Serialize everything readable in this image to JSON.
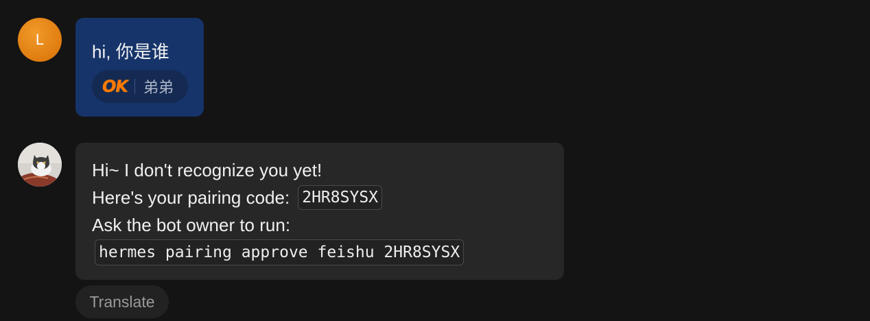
{
  "user_message": {
    "avatar_initial": "L",
    "text": "hi, 你是谁",
    "reaction": {
      "emoji_text": "OK",
      "reactor_name": "弟弟"
    }
  },
  "bot_message": {
    "line1": "Hi~ I don't recognize you yet!",
    "line2_prefix": "Here's your pairing code:",
    "pairing_code": "2HR8SYSX",
    "line3": "Ask the bot owner to run:",
    "command": "hermes pairing approve feishu 2HR8SYSX"
  },
  "actions": {
    "translate_label": "Translate"
  },
  "colors": {
    "background": "#141414",
    "user_bubble": "#16346a",
    "bot_bubble": "#272727",
    "user_avatar": "#e07c10",
    "ok_emoji": "#ff7a00"
  }
}
